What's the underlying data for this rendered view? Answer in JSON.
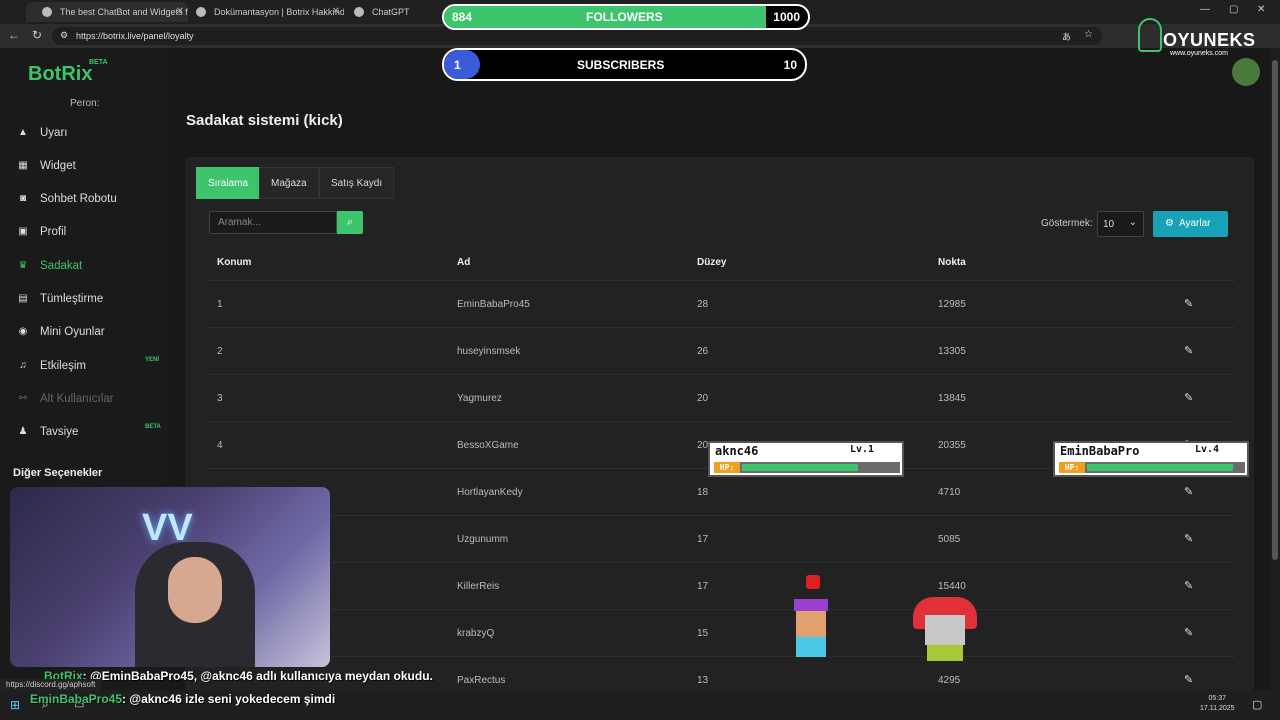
{
  "browser": {
    "tabs": [
      {
        "title": "The best ChatBot and Widgets fo",
        "active": true
      },
      {
        "title": "Dokümantasyon | Botrix Hakkında",
        "active": false
      },
      {
        "title": "ChatGPT",
        "active": false
      }
    ],
    "url": "https://botrix.live/panel/loyalty"
  },
  "overlay": {
    "followers": {
      "current": "884",
      "label": "FOLLOWERS",
      "goal": "1000",
      "progress": 0.884
    },
    "subscribers": {
      "current": "1",
      "label": "SUBSCRIBERS",
      "goal": "10",
      "progress": 0.1
    },
    "brand": {
      "name": "OYUNEKS",
      "url": "www.oyuneks.com"
    },
    "hp_boxes": [
      {
        "name": "aknc46",
        "level": "Lv.1",
        "hp_label": "HP:",
        "hp": 0.75
      },
      {
        "name": "EminBabaPro",
        "level": "Lv.4",
        "hp_label": "HP:",
        "hp": 0.95
      }
    ]
  },
  "sidebar": {
    "logo": "BotRix",
    "logo_badge": "BETA",
    "user": "Peron:",
    "items": [
      {
        "label": "Uyarı",
        "icon": "warning-icon"
      },
      {
        "label": "Widget",
        "icon": "widget-icon"
      },
      {
        "label": "Sohbet Robotu",
        "icon": "robot-icon"
      },
      {
        "label": "Profil",
        "icon": "profile-icon"
      },
      {
        "label": "Sadakat",
        "icon": "trophy-icon"
      },
      {
        "label": "Tümleştirme",
        "icon": "integration-icon"
      },
      {
        "label": "Mini Oyunlar",
        "icon": "gamepad-icon"
      },
      {
        "label": "Etkileşim",
        "icon": "music-icon",
        "badge": "YENİ"
      },
      {
        "label": "Alt Kullanıcılar",
        "icon": "link-icon"
      },
      {
        "label": "Tavsiye",
        "icon": "users-icon",
        "badge": "BETA"
      }
    ],
    "other_options": "Diğer Seçenekler"
  },
  "main": {
    "title": "Sadakat sistemi (kick)",
    "tabs": [
      "Sıralama",
      "Mağaza",
      "Satış Kaydı"
    ],
    "search_placeholder": "Aramak...",
    "show_label": "Göstermek:",
    "show_value": "10",
    "settings_label": "Ayarlar",
    "columns": [
      "Konum",
      "Ad",
      "Düzey",
      "Nokta"
    ],
    "rows": [
      {
        "pos": "1",
        "name": "EminBabaPro45",
        "level": "28",
        "points": "12985"
      },
      {
        "pos": "2",
        "name": "huseyinsmsek",
        "level": "26",
        "points": "13305"
      },
      {
        "pos": "3",
        "name": "Yagmurez",
        "level": "20",
        "points": "13845"
      },
      {
        "pos": "4",
        "name": "BessoXGame",
        "level": "20",
        "points": "20355"
      },
      {
        "pos": "",
        "name": "HortlayanKedy",
        "level": "18",
        "points": "4710"
      },
      {
        "pos": "",
        "name": "Uzgunumm",
        "level": "17",
        "points": "5085"
      },
      {
        "pos": "",
        "name": "KillerReis",
        "level": "17",
        "points": "15440"
      },
      {
        "pos": "",
        "name": "krabzyQ",
        "level": "15",
        "points": ""
      },
      {
        "pos": "",
        "name": "PaxRectus",
        "level": "13",
        "points": "4295"
      }
    ]
  },
  "chat": [
    {
      "user": "BotRix",
      "message": ": @EminBabaPro45, @aknc46 adlı kullanıcıya meydan okudu."
    },
    {
      "user": "EminBabaPro45",
      "message": ": @aknc46 izle seni yokedecem şimdi"
    }
  ],
  "status_url": "https://discord.gg/aphsoft",
  "taskbar": {
    "time": "05:37",
    "date": "17.11.2025"
  }
}
